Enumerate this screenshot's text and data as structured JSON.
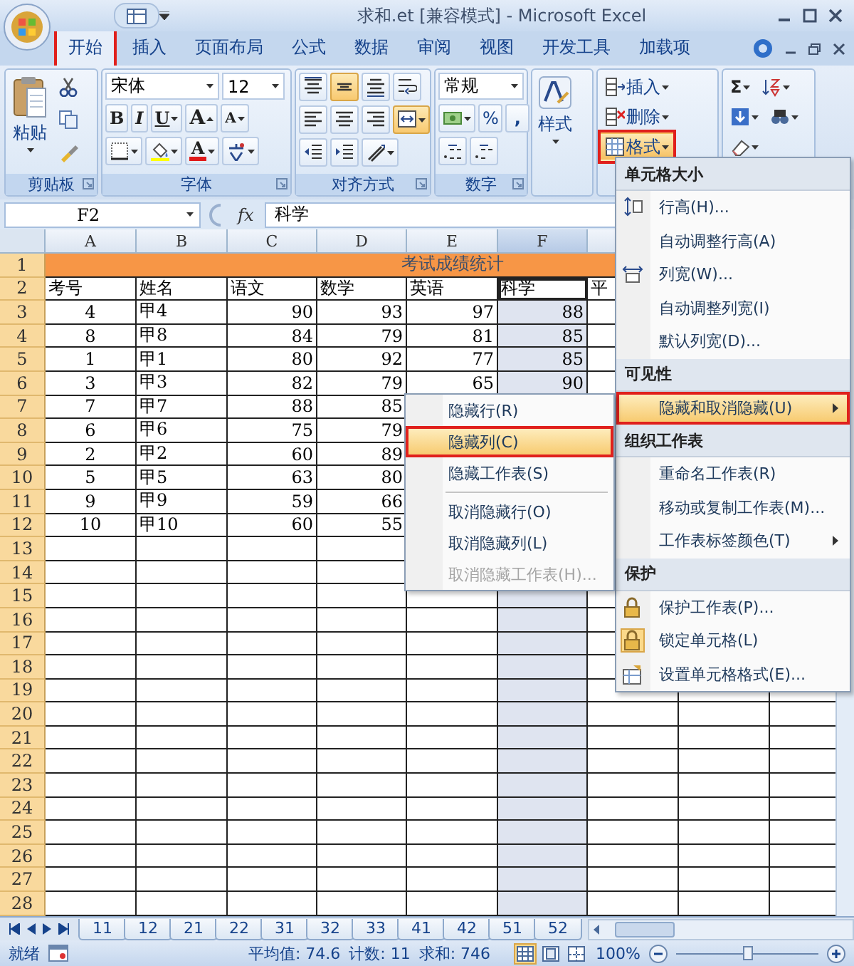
{
  "window": {
    "title": "求和.et  [兼容模式] - Microsoft Excel"
  },
  "ribbon_tabs": [
    {
      "label": "开始",
      "selected": true
    },
    {
      "label": "插入",
      "selected": false
    },
    {
      "label": "页面布局",
      "selected": false
    },
    {
      "label": "公式",
      "selected": false
    },
    {
      "label": "数据",
      "selected": false
    },
    {
      "label": "审阅",
      "selected": false
    },
    {
      "label": "视图",
      "selected": false
    },
    {
      "label": "开发工具",
      "selected": false
    },
    {
      "label": "加载项",
      "selected": false
    }
  ],
  "ribbon": {
    "clipboard": {
      "paste": "粘贴",
      "label": "剪贴板"
    },
    "font": {
      "name": "宋体",
      "size": "12",
      "bold": "B",
      "italic": "I",
      "underline": "U",
      "grow": "A",
      "shrink": "A",
      "font_color_label": "A",
      "label": "字体"
    },
    "alignment": {
      "label": "对齐方式",
      "buttons": [
        {
          "on": false
        },
        {
          "on": true
        },
        {
          "on": false
        },
        {
          "on": false
        },
        {
          "on": false
        },
        {
          "on": false
        },
        {
          "on": false
        },
        {
          "on": true
        },
        {
          "on": false
        },
        {
          "on": false
        },
        {
          "on": false
        }
      ]
    },
    "number": {
      "format": "常规",
      "percent": "%",
      "comma": ",",
      "label": "数字"
    },
    "styles": {
      "button": "样式"
    },
    "cells": {
      "insert": "插入",
      "delete": "删除",
      "format": "格式",
      "format_highlighted": true
    },
    "editing": {
      "sum": "Σ"
    }
  },
  "formula_bar": {
    "cell": "F2",
    "function_label": "fx",
    "content": "科学"
  },
  "columns": [
    {
      "label": "A",
      "selected": false
    },
    {
      "label": "B",
      "selected": false
    },
    {
      "label": "C",
      "selected": false
    },
    {
      "label": "D",
      "selected": false
    },
    {
      "label": "E",
      "selected": false
    },
    {
      "label": "F",
      "selected": true
    }
  ],
  "rows": [
    {
      "number": "1",
      "kind": "title",
      "text": "考试成绩统计"
    },
    {
      "number": "2",
      "kind": "header",
      "cells": [
        "考号",
        "姓名",
        "语文",
        "数学",
        "英语",
        "科学",
        "平"
      ]
    },
    {
      "number": "3",
      "kind": "data",
      "cells": [
        "4",
        "甲4",
        "90",
        "93",
        "97",
        "88"
      ]
    },
    {
      "number": "4",
      "kind": "data",
      "cells": [
        "8",
        "甲8",
        "84",
        "79",
        "81",
        "85"
      ]
    },
    {
      "number": "5",
      "kind": "data",
      "cells": [
        "1",
        "甲1",
        "80",
        "92",
        "77",
        "85"
      ]
    },
    {
      "number": "6",
      "kind": "data",
      "cells": [
        "3",
        "甲3",
        "82",
        "79",
        "65",
        "90"
      ]
    },
    {
      "number": "7",
      "kind": "data",
      "cells": [
        "7",
        "甲7",
        "88",
        "85"
      ]
    },
    {
      "number": "8",
      "kind": "data",
      "cells": [
        "6",
        "甲6",
        "75",
        "79"
      ]
    },
    {
      "number": "9",
      "kind": "data",
      "cells": [
        "2",
        "甲2",
        "60",
        "89"
      ]
    },
    {
      "number": "10",
      "kind": "data",
      "cells": [
        "5",
        "甲5",
        "63",
        "80"
      ]
    },
    {
      "number": "11",
      "kind": "data",
      "cells": [
        "9",
        "甲9",
        "59",
        "66"
      ]
    },
    {
      "number": "12",
      "kind": "data",
      "cells": [
        "10",
        "甲10",
        "60",
        "55"
      ]
    },
    {
      "number": "13",
      "kind": "empty"
    },
    {
      "number": "14",
      "kind": "empty"
    },
    {
      "number": "15",
      "kind": "empty"
    },
    {
      "number": "16",
      "kind": "empty"
    },
    {
      "number": "17",
      "kind": "empty"
    },
    {
      "number": "18",
      "kind": "empty"
    },
    {
      "number": "19",
      "kind": "empty"
    },
    {
      "number": "20",
      "kind": "empty"
    },
    {
      "number": "21",
      "kind": "empty"
    },
    {
      "number": "22",
      "kind": "empty"
    },
    {
      "number": "23",
      "kind": "empty"
    },
    {
      "number": "24",
      "kind": "empty"
    },
    {
      "number": "25",
      "kind": "empty"
    },
    {
      "number": "26",
      "kind": "empty"
    },
    {
      "number": "27",
      "kind": "empty"
    },
    {
      "number": "28",
      "kind": "empty"
    }
  ],
  "format_menu": [
    {
      "kind": "header",
      "label": "单元格大小"
    },
    {
      "kind": "item",
      "label": "行高(H)...",
      "highlighted": false,
      "checked": false,
      "submenu": false
    },
    {
      "kind": "item",
      "label": "自动调整行高(A)",
      "highlighted": false,
      "checked": false,
      "submenu": false
    },
    {
      "kind": "item",
      "label": "列宽(W)...",
      "highlighted": false,
      "checked": false,
      "submenu": false
    },
    {
      "kind": "item",
      "label": "自动调整列宽(I)",
      "highlighted": false,
      "checked": false,
      "submenu": false
    },
    {
      "kind": "item",
      "label": "默认列宽(D)...",
      "highlighted": false,
      "checked": false,
      "submenu": false
    },
    {
      "kind": "header",
      "label": "可见性"
    },
    {
      "kind": "item",
      "label": "隐藏和取消隐藏(U)",
      "highlighted": true,
      "checked": false,
      "submenu": true
    },
    {
      "kind": "header",
      "label": "组织工作表"
    },
    {
      "kind": "item",
      "label": "重命名工作表(R)",
      "highlighted": false,
      "checked": false,
      "submenu": false
    },
    {
      "kind": "item",
      "label": "移动或复制工作表(M)...",
      "highlighted": false,
      "checked": false,
      "submenu": false
    },
    {
      "kind": "item",
      "label": "工作表标签颜色(T)",
      "highlighted": false,
      "checked": false,
      "submenu": true
    },
    {
      "kind": "header",
      "label": "保护"
    },
    {
      "kind": "item",
      "label": "保护工作表(P)...",
      "highlighted": false,
      "checked": false,
      "submenu": false
    },
    {
      "kind": "item",
      "label": "锁定单元格(L)",
      "highlighted": false,
      "checked": true,
      "submenu": false
    },
    {
      "kind": "item",
      "label": "设置单元格格式(E)...",
      "highlighted": false,
      "checked": false,
      "submenu": false
    }
  ],
  "hide_submenu": [
    {
      "kind": "item",
      "label": "隐藏行(R)",
      "highlighted": false,
      "disabled": false
    },
    {
      "kind": "item",
      "label": "隐藏列(C)",
      "highlighted": true,
      "disabled": false
    },
    {
      "kind": "item",
      "label": "隐藏工作表(S)",
      "highlighted": false,
      "disabled": false
    },
    {
      "kind": "separator"
    },
    {
      "kind": "item",
      "label": "取消隐藏行(O)",
      "highlighted": false,
      "disabled": false
    },
    {
      "kind": "item",
      "label": "取消隐藏列(L)",
      "highlighted": false,
      "disabled": false
    },
    {
      "kind": "item",
      "label": "取消隐藏工作表(H)...",
      "highlighted": false,
      "disabled": true
    }
  ],
  "sheet_tabs": [
    {
      "label": "11",
      "selected": false
    },
    {
      "label": "12",
      "selected": false
    },
    {
      "label": "21",
      "selected": false
    },
    {
      "label": "22",
      "selected": false
    },
    {
      "label": "31",
      "selected": false
    },
    {
      "label": "32",
      "selected": false
    },
    {
      "label": "33",
      "selected": false
    },
    {
      "label": "41",
      "selected": false
    },
    {
      "label": "42",
      "selected": false
    },
    {
      "label": "51",
      "selected": false
    },
    {
      "label": "52",
      "selected": false
    }
  ],
  "status_bar": {
    "mode": "就绪",
    "average": "平均值: 74.6",
    "count": "计数: 11",
    "sum": "求和: 746",
    "views": [
      {
        "selected": true
      },
      {
        "selected": false
      },
      {
        "selected": false
      }
    ],
    "zoom": {
      "label": "100%",
      "level": 0.5
    }
  }
}
